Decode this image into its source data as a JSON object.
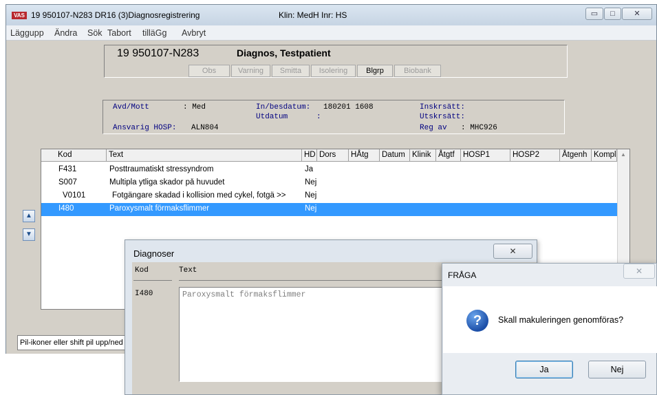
{
  "window": {
    "app_badge": "VAS",
    "title": "19 950107-N283   DR16 (3)Diagnosregistrering",
    "klin": "Klin: MedH  Inr: HS",
    "minimize": "▭",
    "maximize": "□",
    "close": "✕"
  },
  "menu": [
    "Läggupp",
    "Ändra",
    "Sök",
    "Tabort",
    "tilläGg",
    "Avbryt"
  ],
  "patient": {
    "id": "19 950107-N283",
    "name": "Diagnos, Testpatient",
    "toolbar": [
      "Obs",
      "Varning",
      "Smitta",
      "Isolering",
      "Blgrp",
      "Biobank"
    ]
  },
  "info": {
    "avd_label": "Avd/Mott",
    "avd_value": ": Med",
    "in_label": "In/besdatum:",
    "in_value": "180201 1608",
    "ut_label": "Utdatum",
    "ut_value": ":",
    "inskr_label": "Inskrsätt:",
    "utskr_label": "Utskrsätt:",
    "ansv_label": "Ansvarig HOSP:",
    "ansv_value": "ALN804",
    "regav_label": "Reg av",
    "regav_value": ": MHC926"
  },
  "grid": {
    "columns": [
      "Kod",
      "Text",
      "HD",
      "Dors",
      "HÅtg",
      "Datum",
      "Klinik",
      "Åtgtf",
      "HOSP1",
      "HOSP2",
      "Åtgenh",
      "Kompl"
    ],
    "rows": [
      {
        "kod": "F431",
        "text": "Posttraumatiskt stressyndrom",
        "hd": "Ja"
      },
      {
        "kod": "S007",
        "text": "Multipla ytliga skador på huvudet",
        "hd": "Nej"
      },
      {
        "kod": "V0101",
        "text": "Fotgängare skadad i kollision med cykel, fotgä >>",
        "hd": "Nej"
      },
      {
        "kod": "I480",
        "text": "Paroxysmalt förmaksflimmer",
        "hd": "Nej"
      }
    ],
    "selected_row": 3
  },
  "side_buttons": {
    "up": "▲",
    "down": "▼"
  },
  "statusbar": "Pil-ikoner eller shift pil upp/ned",
  "diagnoser": {
    "title": "Diagnoser",
    "close": "✕",
    "kod_header": "Kod",
    "text_header": "Text",
    "kod_value": "I480",
    "text_value": "Paroxysmalt förmaksflimmer"
  },
  "fraga": {
    "title": "FRÅGA",
    "close": "✕",
    "icon": "?",
    "message": "Skall makuleringen genomföras?",
    "yes": "Ja",
    "no": "Nej"
  }
}
